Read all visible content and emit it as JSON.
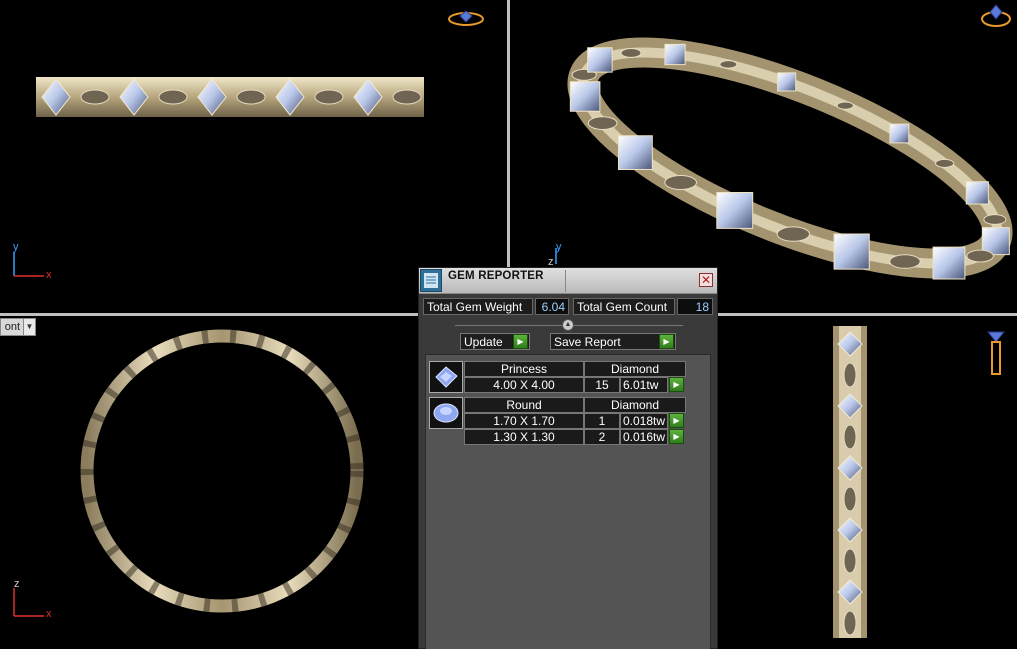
{
  "gem_reporter": {
    "title": "GEM REPORTER",
    "total_weight_label": "Total Gem Weight",
    "total_weight_value": "6.04",
    "total_count_label": "Total Gem Count",
    "total_count_value": "18",
    "update_label": "Update",
    "save_report_label": "Save Report",
    "gem_groups": [
      {
        "shape": "Princess",
        "material": "Diamond",
        "rows": [
          {
            "size": "4.00 X 4.00",
            "count": "15",
            "weight": "6.01tw"
          }
        ]
      },
      {
        "shape": "Round",
        "material": "Diamond",
        "rows": [
          {
            "size": "1.70 X 1.70",
            "count": "1",
            "weight": "0.018tw"
          },
          {
            "size": "1.30 X 1.30",
            "count": "2",
            "weight": "0.016tw"
          }
        ]
      }
    ]
  },
  "viewports": {
    "top": {
      "axis_up": "y",
      "axis_right": "x"
    },
    "perspective": {
      "axis_up": "y",
      "axis_right": "z"
    },
    "front": {
      "axis_up": "z",
      "axis_right": "x",
      "view_dropdown": "ont"
    }
  },
  "colors": {
    "axis_x": "#e0302a",
    "axis_y": "#3aa0ff",
    "metal": "#cfc3a0",
    "go_button": "#3f9a26"
  },
  "icons": {
    "viewport_top": "ring-nav-icon",
    "viewport_persp": "ring-nav-icon",
    "viewport_right": "ring-side-nav-icon",
    "gem_princess": "princess-gem-icon",
    "gem_round": "round-gem-icon"
  }
}
